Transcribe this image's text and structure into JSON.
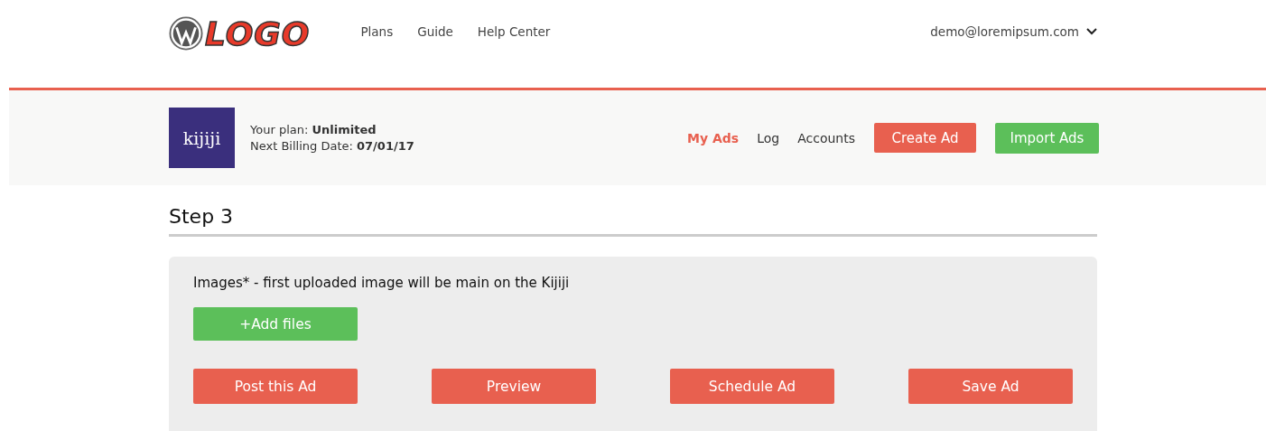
{
  "header": {
    "logo_text": "LOGO",
    "nav": [
      "Plans",
      "Guide",
      "Help Center"
    ],
    "user_email": "demo@loremipsum.com"
  },
  "plan_bar": {
    "brand_text": "kijiji",
    "plan_label": "Your plan: ",
    "plan_value": "Unlimited",
    "billing_label": "Next Billing Date: ",
    "billing_value": "07/01/17",
    "tabs": [
      {
        "label": "My Ads",
        "selected": true
      },
      {
        "label": "Log",
        "selected": false
      },
      {
        "label": "Accounts",
        "selected": false
      }
    ],
    "buttons": [
      {
        "label": "Create Ad",
        "kind": "red"
      },
      {
        "label": "Import Ads",
        "kind": "green"
      }
    ]
  },
  "step_title": "Step 3",
  "images_panel": {
    "label": "Images* - first uploaded image will be main on the Kijiji",
    "add_button": {
      "label": "+Add files",
      "kind": "green"
    },
    "actions": [
      {
        "label": "Post this Ad",
        "kind": "red"
      },
      {
        "label": "Preview",
        "kind": "red"
      },
      {
        "label": "Schedule Ad",
        "kind": "red"
      },
      {
        "label": "Save Ad",
        "kind": "red"
      }
    ]
  }
}
